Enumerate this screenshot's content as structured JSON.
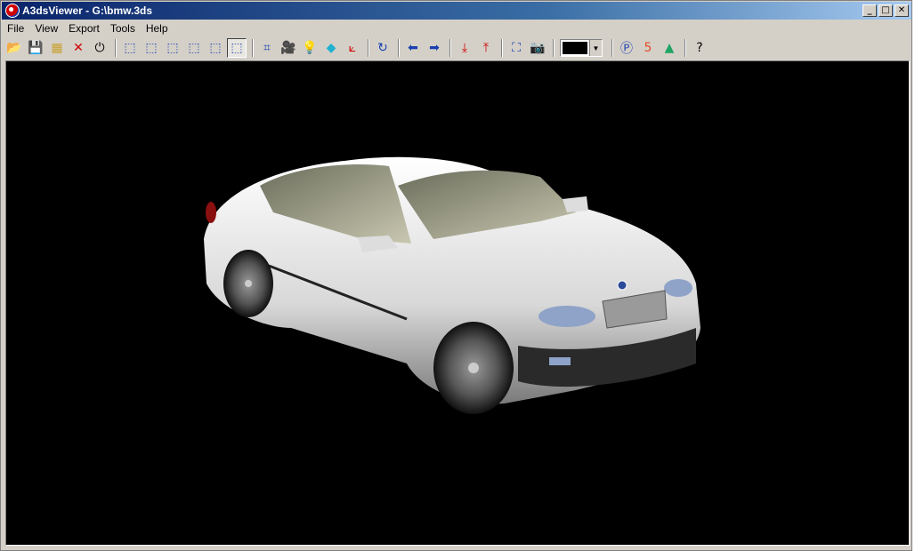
{
  "window": {
    "title": "A3dsViewer - G:\\bmw.3ds",
    "minimize_glyph": "_",
    "maximize_glyph": "□",
    "close_glyph": "✕"
  },
  "menu": {
    "file": "File",
    "view": "View",
    "export": "Export",
    "tools": "Tools",
    "help": "Help"
  },
  "toolbar": {
    "background_color": "#000000",
    "icons": [
      {
        "name": "open-folder-icon",
        "glyph": "📂",
        "color": "#c89a2a"
      },
      {
        "name": "save-icon",
        "glyph": "💾",
        "color": "#1a3fb0"
      },
      {
        "name": "grid-icon",
        "glyph": "▦",
        "color": "#c8a030"
      },
      {
        "name": "close-file-icon",
        "glyph": "✕",
        "color": "#d00000"
      },
      {
        "name": "power-icon",
        "glyph": "⏻",
        "color": "#000000"
      }
    ],
    "view_icons": [
      {
        "name": "view-front-icon",
        "glyph": "⬚"
      },
      {
        "name": "view-back-icon",
        "glyph": "⬚"
      },
      {
        "name": "view-left-icon",
        "glyph": "⬚"
      },
      {
        "name": "view-right-icon",
        "glyph": "⬚"
      },
      {
        "name": "view-top-icon",
        "glyph": "⬚"
      },
      {
        "name": "view-perspective-icon",
        "glyph": "⬚"
      }
    ],
    "tool_icons": [
      {
        "name": "wireframe-icon",
        "glyph": "⌗",
        "color": "#1a3fb0"
      },
      {
        "name": "camera-reel-icon",
        "glyph": "🎥",
        "color": "#404040"
      },
      {
        "name": "light-bulb-icon",
        "glyph": "💡",
        "color": "#e0c020"
      },
      {
        "name": "cube-icon",
        "glyph": "◆",
        "color": "#20b0d0"
      },
      {
        "name": "axes-icon",
        "glyph": "⟀",
        "color": "#d00000"
      }
    ],
    "rotate_icon": {
      "name": "rotate-icon",
      "glyph": "↻",
      "color": "#1a3fb0"
    },
    "nav_icons": [
      {
        "name": "arrow-left-icon",
        "glyph": "⬅",
        "color": "#1a3fb0"
      },
      {
        "name": "arrow-right-icon",
        "glyph": "➡",
        "color": "#1a3fb0"
      }
    ],
    "updown_icons": [
      {
        "name": "move-down-icon",
        "glyph": "⤓",
        "color": "#d00000"
      },
      {
        "name": "move-up-icon",
        "glyph": "⤒",
        "color": "#d00000"
      }
    ],
    "capture_icons": [
      {
        "name": "fit-view-icon",
        "glyph": "⛶",
        "color": "#1a3fb0"
      },
      {
        "name": "screenshot-camera-icon",
        "glyph": "📷",
        "color": "#404040"
      }
    ],
    "share_icons": [
      {
        "name": "paypal-icon",
        "glyph": "Ⓟ",
        "color": "#1a3fb0"
      },
      {
        "name": "html5-icon",
        "glyph": "5",
        "color": "#e34c26"
      },
      {
        "name": "google-drive-icon",
        "glyph": "▲",
        "color": "#1fa463"
      }
    ],
    "help_icon": {
      "name": "help-icon",
      "glyph": "?",
      "color": "#000000"
    }
  }
}
